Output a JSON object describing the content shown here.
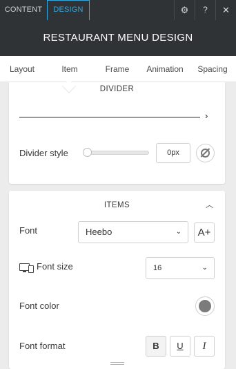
{
  "top_tabs": {
    "content": "CONTENT",
    "design": "DESIGN"
  },
  "top_icons": {
    "settings": "⚙",
    "help": "?",
    "close": "✕"
  },
  "title": "RESTAURANT MENU DESIGN",
  "sub_tabs": [
    "Layout",
    "Item",
    "Frame",
    "Animation",
    "Spacing"
  ],
  "active_sub_tab": "Item",
  "divider_section": {
    "title": "DIVIDER",
    "chevron": "›",
    "style_label": "Divider style",
    "slider_value": 0,
    "px_value": "0px"
  },
  "items_section": {
    "title": "ITEMS",
    "collapse_chevron": "︿",
    "font_label": "Font",
    "font_value": "Heebo",
    "add_font": "A+",
    "font_size_label": "Font size",
    "font_size_value": "16",
    "font_color_label": "Font color",
    "font_color": "#7b7b7b",
    "font_format_label": "Font format",
    "format_bold": "B",
    "format_underline": "U",
    "format_italic": "I"
  },
  "select_chevron": "⌄",
  "colors": {
    "accent": "#32a7e0",
    "header_bg": "#2f3336"
  }
}
